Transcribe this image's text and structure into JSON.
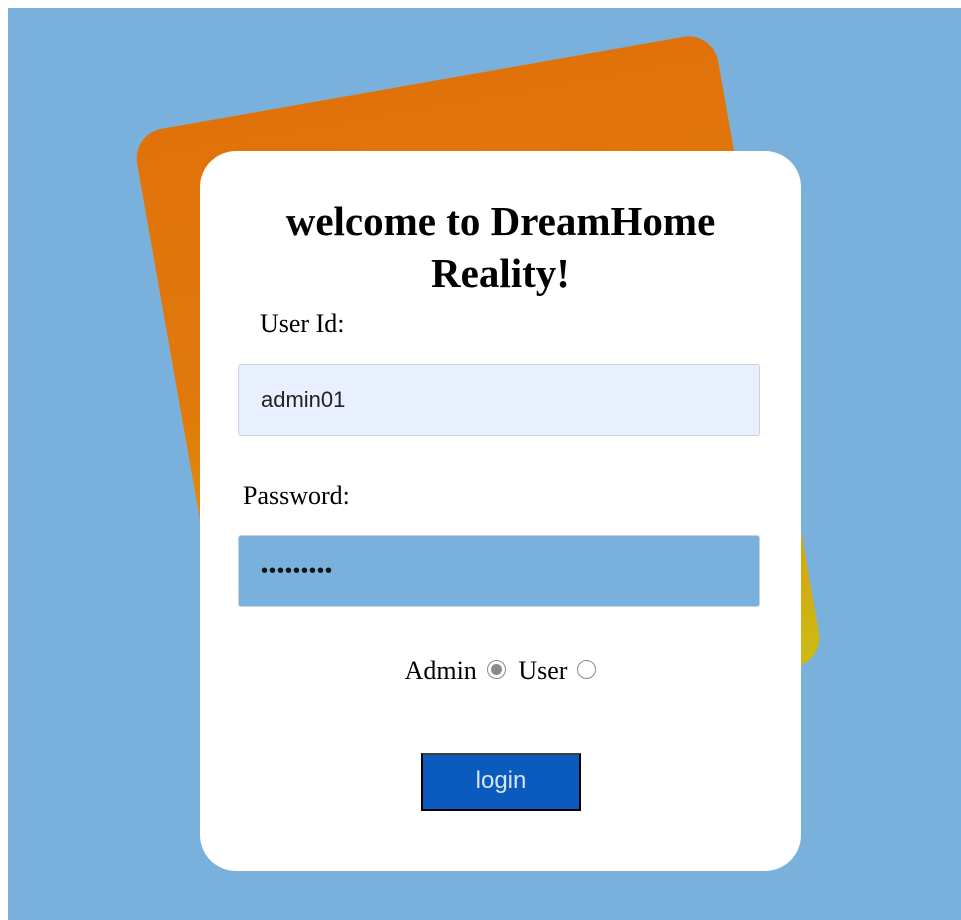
{
  "title": "welcome to DreamHome Reality!",
  "form": {
    "user_id_label": "User Id:",
    "user_id_value": "admin01",
    "password_label": "Password:",
    "password_value": "•••••••••",
    "role_options": [
      {
        "label": "Admin",
        "selected": true
      },
      {
        "label": "User",
        "selected": false
      }
    ],
    "login_label": "login"
  },
  "colors": {
    "background": "#7ab1dc",
    "back_card_top": "#e1720a",
    "back_card_bottom": "#cdbb14",
    "card": "#ffffff",
    "user_field": "#e8f0fe",
    "password_field": "#7ab1dc",
    "login_button": "#0b5bbf"
  }
}
